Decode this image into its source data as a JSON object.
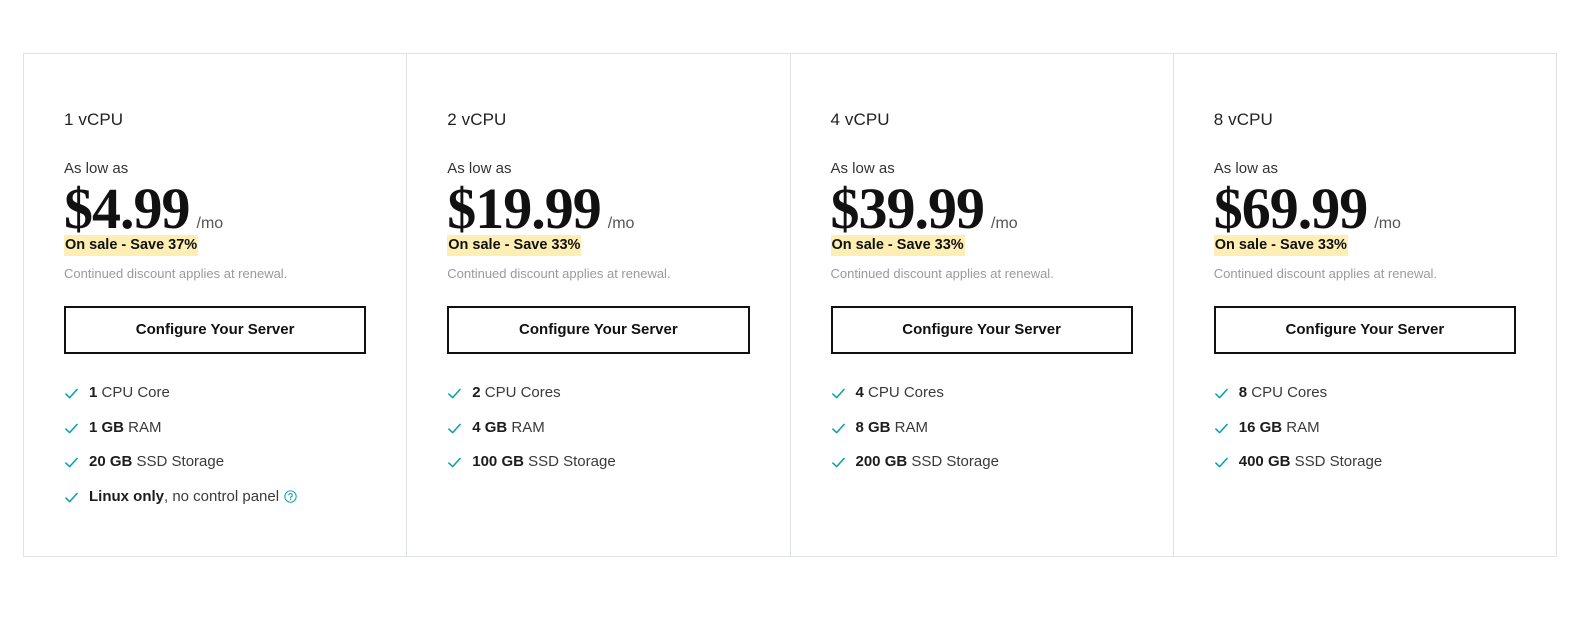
{
  "colors": {
    "check": "#00a0af",
    "sale_highlight": "#fdeeb4",
    "border": "#dfe3e8",
    "button_border": "#111111",
    "muted_text": "#9a9a9a"
  },
  "common": {
    "as_low_as": "As low as",
    "period": "/mo",
    "renewal_note": "Continued discount applies at renewal.",
    "cta_label": "Configure Your Server",
    "check_icon": "check-icon",
    "help_icon": "help-circle-icon"
  },
  "plans": [
    {
      "title": "1 vCPU",
      "as_low_as": "As low as",
      "price": "$4.99",
      "period": "/mo",
      "sale": "On sale - Save 37%",
      "renewal_note": "Continued discount applies at renewal.",
      "cta_label": "Configure Your Server",
      "features": [
        {
          "strong": "1",
          "rest": " CPU Core",
          "help": false
        },
        {
          "strong": "1 GB",
          "rest": " RAM",
          "help": false
        },
        {
          "strong": "20 GB",
          "rest": " SSD Storage",
          "help": false
        },
        {
          "strong": "Linux only",
          "rest": ", no control panel",
          "help": true
        }
      ]
    },
    {
      "title": "2 vCPU",
      "as_low_as": "As low as",
      "price": "$19.99",
      "period": "/mo",
      "sale": "On sale - Save 33%",
      "renewal_note": "Continued discount applies at renewal.",
      "cta_label": "Configure Your Server",
      "features": [
        {
          "strong": "2",
          "rest": " CPU Cores",
          "help": false
        },
        {
          "strong": "4 GB",
          "rest": " RAM",
          "help": false
        },
        {
          "strong": "100 GB",
          "rest": " SSD Storage",
          "help": false
        }
      ]
    },
    {
      "title": "4 vCPU",
      "as_low_as": "As low as",
      "price": "$39.99",
      "period": "/mo",
      "sale": "On sale - Save 33%",
      "renewal_note": "Continued discount applies at renewal.",
      "cta_label": "Configure Your Server",
      "features": [
        {
          "strong": "4",
          "rest": " CPU Cores",
          "help": false
        },
        {
          "strong": "8 GB",
          "rest": " RAM",
          "help": false
        },
        {
          "strong": "200 GB",
          "rest": " SSD Storage",
          "help": false
        }
      ]
    },
    {
      "title": "8 vCPU",
      "as_low_as": "As low as",
      "price": "$69.99",
      "period": "/mo",
      "sale": "On sale - Save 33%",
      "renewal_note": "Continued discount applies at renewal.",
      "cta_label": "Configure Your Server",
      "features": [
        {
          "strong": "8",
          "rest": " CPU Cores",
          "help": false
        },
        {
          "strong": "16 GB",
          "rest": " RAM",
          "help": false
        },
        {
          "strong": "400 GB",
          "rest": " SSD Storage",
          "help": false
        }
      ]
    }
  ]
}
